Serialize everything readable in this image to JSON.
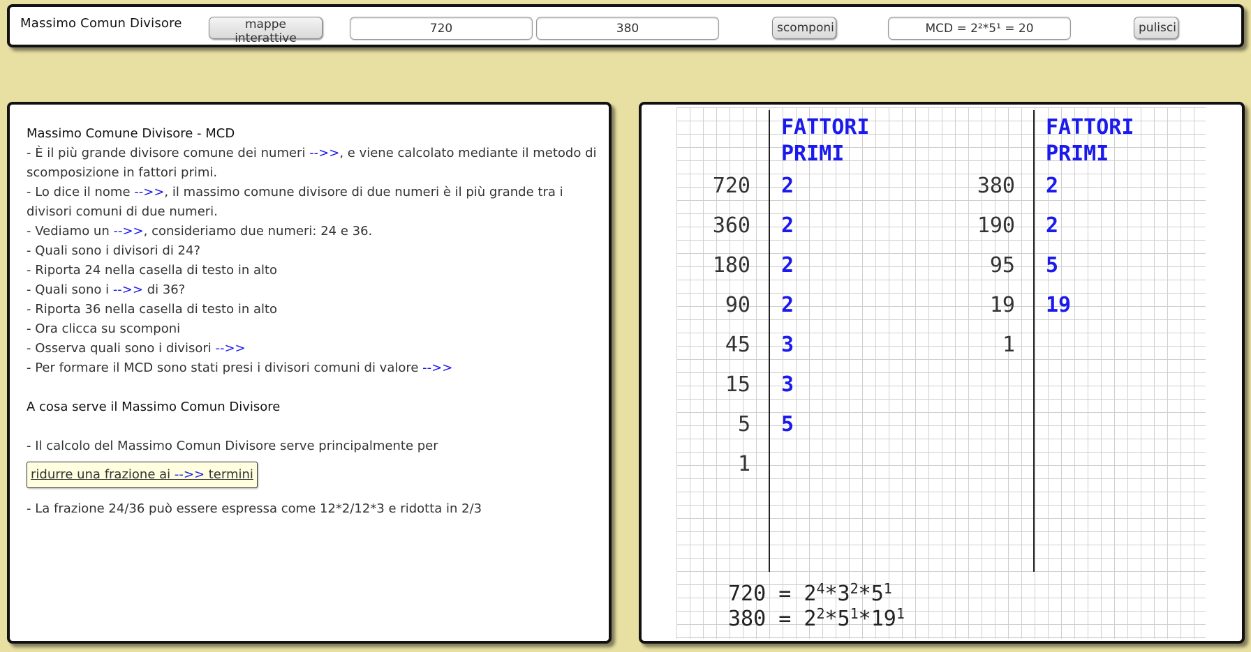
{
  "toolbar": {
    "title": "Massimo Comun Divisore",
    "maps_label": "mappe interattive",
    "number1": "720",
    "number2": "380",
    "decompose_label": "scomponi",
    "result": "MCD = 2²*5¹ = 20",
    "clear_label": "pulisci"
  },
  "info": {
    "heading": "Massimo Comune Divisore - MCD",
    "arrow": "-->>",
    "l1a": "- È il più grande divisore comune dei numeri ",
    "l1b": ", e viene calcolato mediante il metodo di scomposizione in fattori primi.",
    "l2a": "- Lo dice il nome ",
    "l2b": ", il massimo comune divisore di due numeri è il più grande tra i divisori comuni di due numeri.",
    "l3a": "- Vediamo un ",
    "l3b": ", consideriamo due numeri: 24 e 36.",
    "l4": "- Quali sono i divisori di 24?",
    "l5": "- Riporta 24 nella casella di testo in alto",
    "l6a": "- Quali sono i ",
    "l6b": " di 36?",
    "l7": "- Riporta 36 nella casella di testo in alto",
    "l8": "- Ora clicca su scomponi",
    "l9a": "- Osserva quali sono i divisori ",
    "l10a": "- Per formare il MCD sono stati presi i divisori comuni di valore ",
    "section2": "A cosa serve il Massimo Comun Divisore",
    "l11": "- Il calcolo del Massimo Comun Divisore serve principalmente per",
    "link_a": "ridurre una frazione ai ",
    "link_b": " termini",
    "l12": "- La frazione 24/36 può essere espressa come 12*2/12*3 e ridotta in 2/3"
  },
  "worksheet": {
    "col_title_line1": "FATTORI",
    "col_title_line2": "PRIMI",
    "left_numbers": [
      "720",
      "360",
      "180",
      "90",
      "45",
      "15",
      "5",
      "1"
    ],
    "left_factors": [
      "2",
      "2",
      "2",
      "2",
      "3",
      "3",
      "5"
    ],
    "right_numbers": [
      "380",
      "190",
      "95",
      "19",
      "1"
    ],
    "right_factors": [
      "2",
      "2",
      "5",
      "19"
    ],
    "result1_prefix": "720 = ",
    "result1_terms": [
      [
        "2",
        "4"
      ],
      [
        "3",
        "2"
      ],
      [
        "5",
        "1"
      ]
    ],
    "result2_prefix": "380 = ",
    "result2_terms": [
      [
        "2",
        "2"
      ],
      [
        "5",
        "1"
      ],
      [
        "19",
        "1"
      ]
    ],
    "multiply": "*"
  },
  "colors": {
    "background": "#e8dfa3",
    "accent_blue": "#1a1aee",
    "note_box": "#ffffe0"
  }
}
